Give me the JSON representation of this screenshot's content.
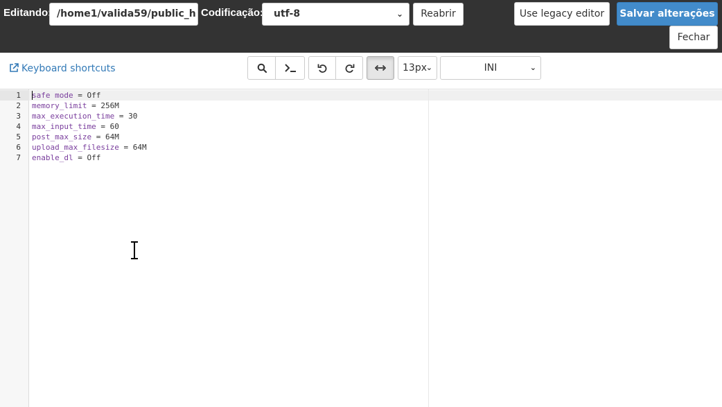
{
  "header": {
    "editing_label": "Editando:",
    "file_path": "/home1/valida59/public_h",
    "encoding_label": "Codificação:",
    "encoding_value": "utf-8",
    "reopen_label": "Reabrir",
    "legacy_label": "Use legacy editor",
    "save_label": "Salvar alterações",
    "close_label": "Fechar"
  },
  "toolbar": {
    "shortcuts_label": "Keyboard shortcuts",
    "font_size": "13px",
    "mode": "INI",
    "buttons": [
      "search-icon",
      "terminal-icon",
      "undo-icon",
      "redo-icon",
      "wrap-icon"
    ]
  },
  "editor": {
    "line_numbers": [
      "1",
      "2",
      "3",
      "4",
      "5",
      "6",
      "7"
    ],
    "lines": [
      {
        "key": "safe mode",
        "rest": " = Off"
      },
      {
        "key": "memory_limit",
        "rest": " = 256M"
      },
      {
        "key": "max_execution_time",
        "rest": " = 30"
      },
      {
        "key": "max_input_time",
        "rest": " = 60"
      },
      {
        "key": "post_max_size",
        "rest": " = 64M"
      },
      {
        "key": "upload_max_filesize",
        "rest": " = 64M"
      },
      {
        "key": "enable_dl",
        "rest": " = Off"
      }
    ]
  },
  "colors": {
    "topbar": "#333333",
    "primary": "#428bca",
    "link": "#337ab7",
    "ini_key": "#7a3e9d"
  }
}
